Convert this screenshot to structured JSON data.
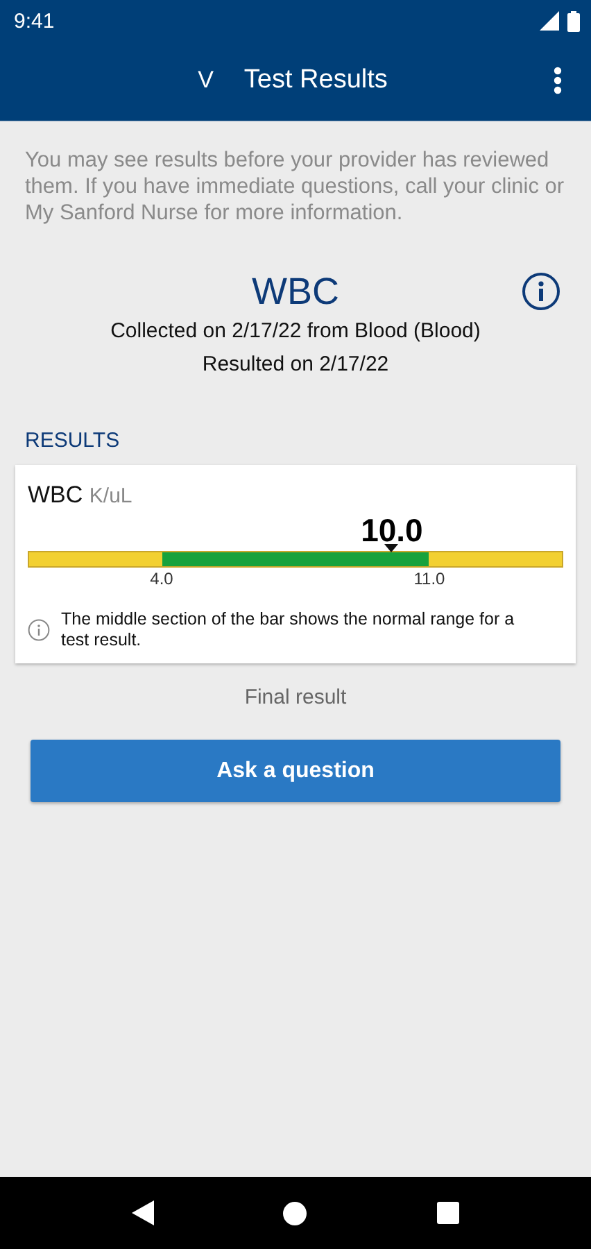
{
  "status_bar": {
    "time": "9:41"
  },
  "header": {
    "logo": "V",
    "title": "Test Results"
  },
  "notice": "You may see results before your provider has reviewed them. If you have immediate questions, call your clinic or My Sanford Nurse for more information.",
  "test": {
    "name": "WBC",
    "collected": "Collected on 2/17/22 from Blood (Blood)",
    "resulted": "Resulted on 2/17/22"
  },
  "section_label": "RESULTS",
  "result_card": {
    "name": "WBC",
    "unit": "K/uL",
    "value": "10.0",
    "level": 0.68,
    "low": "4.0",
    "high": "11.0",
    "note": "The middle section of the bar shows the normal range for a test result."
  },
  "status": "Final result",
  "button": "Ask a question"
}
